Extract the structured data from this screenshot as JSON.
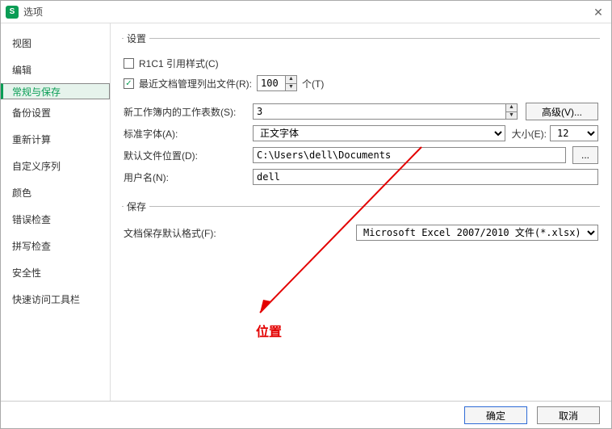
{
  "title": "选项",
  "sidebar": {
    "items": [
      {
        "label": "视图",
        "sel": false
      },
      {
        "label": "编辑",
        "sel": false
      },
      {
        "label": "常规与保存",
        "sel": true
      },
      {
        "label": "备份设置",
        "sel": false
      },
      {
        "label": "重新计算",
        "sel": false
      },
      {
        "label": "自定义序列",
        "sel": false
      },
      {
        "label": "颜色",
        "sel": false
      },
      {
        "label": "错误检查",
        "sel": false
      },
      {
        "label": "拼写检查",
        "sel": false
      },
      {
        "label": "安全性",
        "sel": false
      },
      {
        "label": "快速访问工具栏",
        "sel": false
      }
    ]
  },
  "settings": {
    "legend": "设置",
    "r1c1_label": "R1C1 引用样式(C)",
    "r1c1_checked": false,
    "recent_label": "最近文档管理列出文件(R):",
    "recent_checked": true,
    "recent_value": "100",
    "recent_unit": "个(T)",
    "sheets_label": "新工作簿内的工作表数(S):",
    "sheets_value": "3",
    "advanced_btn": "高级(V)...",
    "font_label": "标准字体(A):",
    "font_value": "正文字体",
    "size_label": "大小(E):",
    "size_value": "12",
    "path_label": "默认文件位置(D):",
    "path_value": "C:\\Users\\dell\\Documents",
    "browse_btn": "...",
    "user_label": "用户名(N):",
    "user_value": "dell"
  },
  "save": {
    "legend": "保存",
    "format_label": "文档保存默认格式(F):",
    "format_value": "Microsoft Excel 2007/2010 文件(*.xlsx)"
  },
  "annotation": "位置",
  "footer": {
    "ok": "确定",
    "cancel": "取消"
  }
}
